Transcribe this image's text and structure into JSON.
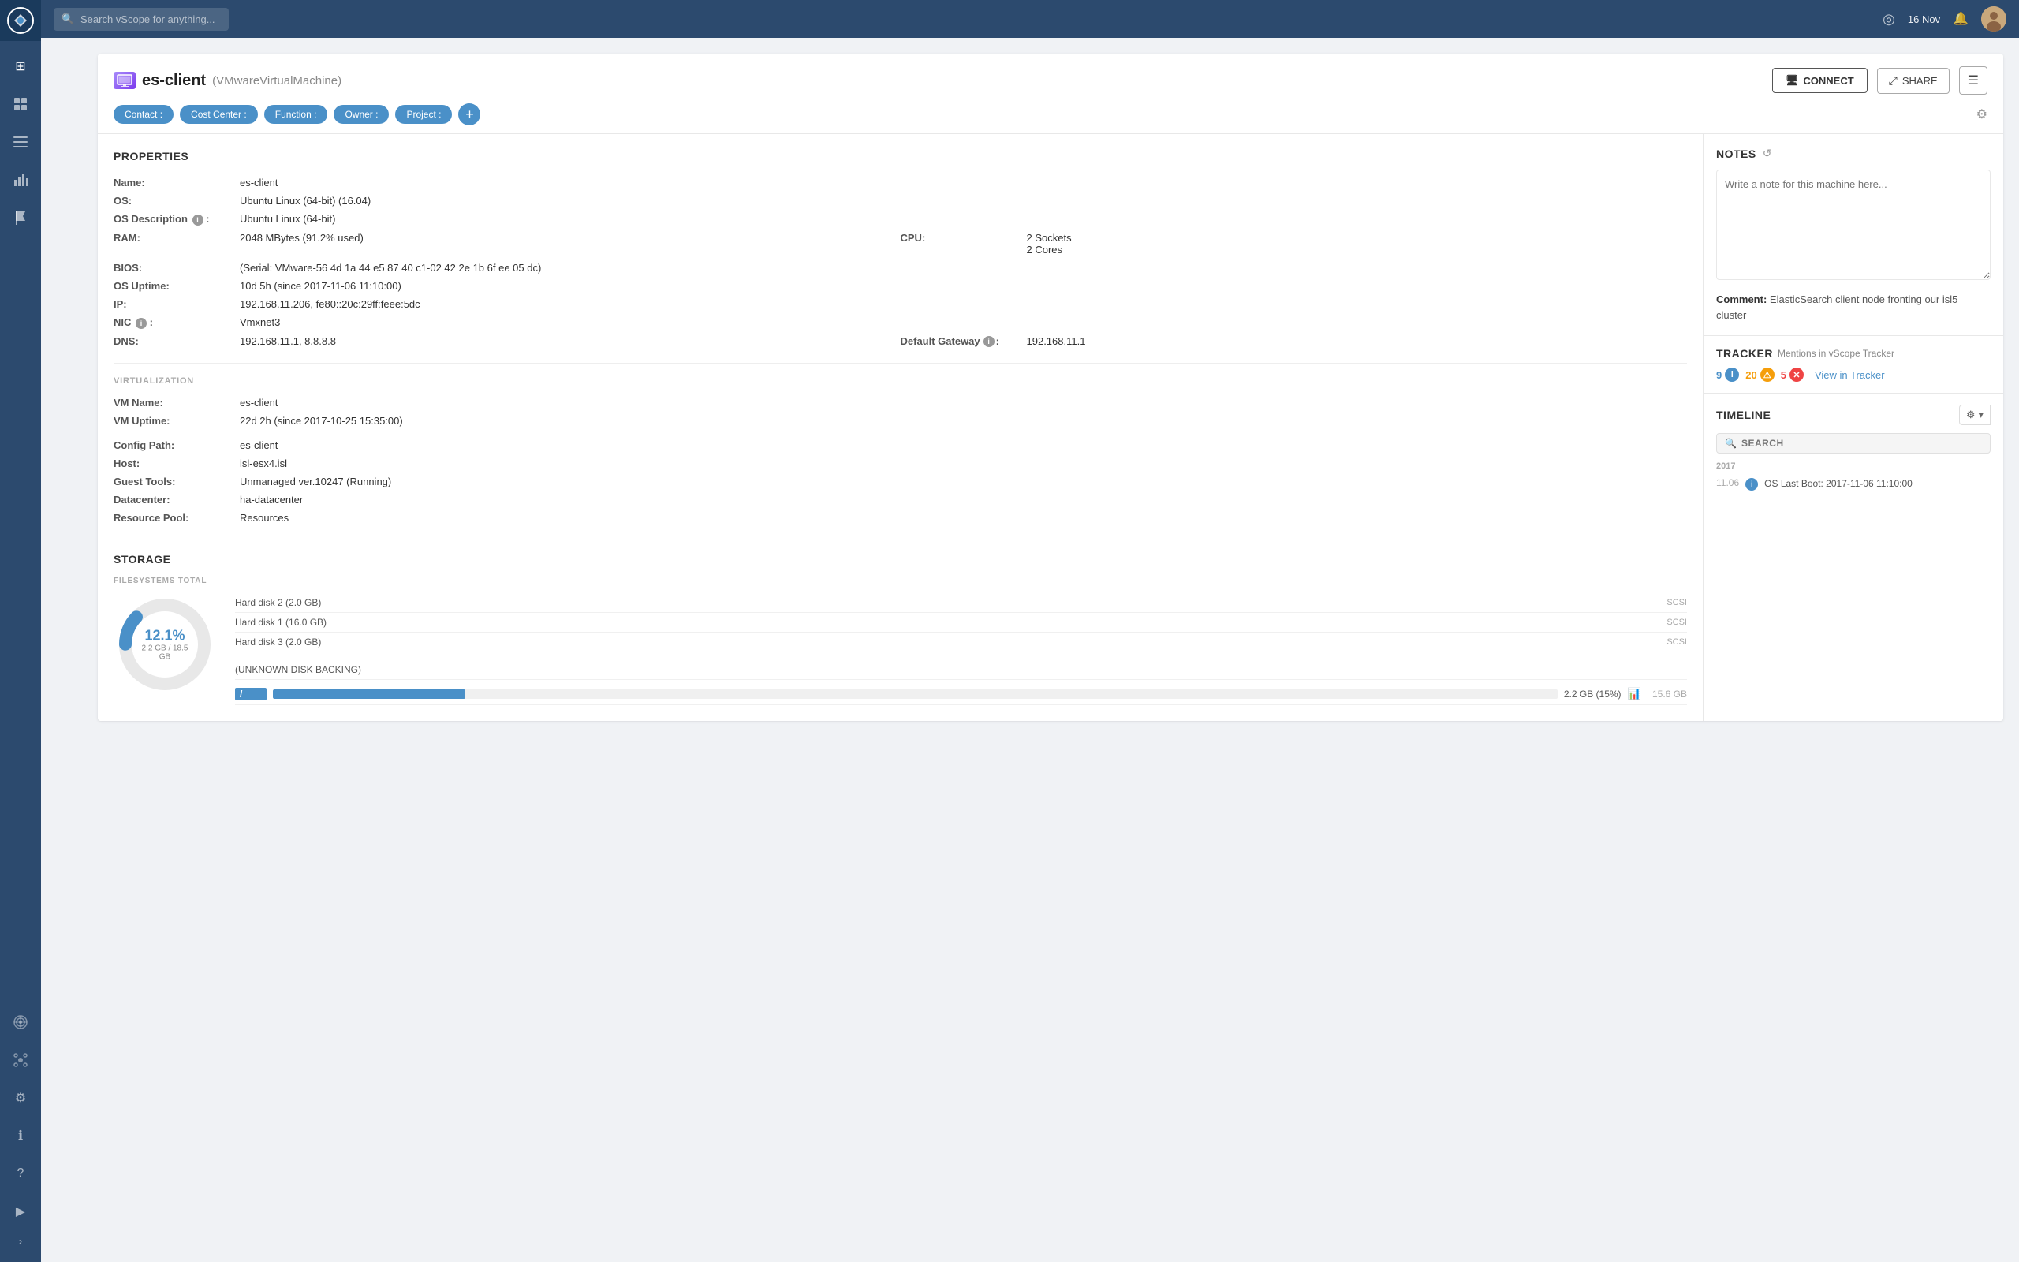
{
  "app": {
    "name": "vScope",
    "logo_text": "vScope"
  },
  "topnav": {
    "search_placeholder": "Search vScope for anything...",
    "date": "16 Nov",
    "connect_label": "CONNECT",
    "share_label": "SHARE"
  },
  "sidebar": {
    "icons": [
      {
        "name": "grid-icon",
        "symbol": "⊞",
        "active": true
      },
      {
        "name": "table-icon",
        "symbol": "☰"
      },
      {
        "name": "text-icon",
        "symbol": "≡"
      },
      {
        "name": "chart-icon",
        "symbol": "▦"
      },
      {
        "name": "flag-icon",
        "symbol": "⚑"
      },
      {
        "name": "globe-icon",
        "symbol": "◎"
      },
      {
        "name": "settings-icon",
        "symbol": "⚙"
      },
      {
        "name": "info-icon",
        "symbol": "ℹ"
      },
      {
        "name": "help-icon",
        "symbol": "?"
      },
      {
        "name": "video-icon",
        "symbol": "▶"
      }
    ],
    "expand_label": "›"
  },
  "page": {
    "vm_type": "VMwareVirtualMachine",
    "title": "es-client",
    "subtitle": "(VMwareVirtualMachine)",
    "tags": {
      "contact": "Contact :",
      "cost_center": "Cost Center :",
      "function": "Function :",
      "owner": "Owner :",
      "project": "Project :",
      "add_label": "+"
    }
  },
  "properties": {
    "section_title": "PROPERTIES",
    "fields": {
      "name_label": "Name:",
      "name_value": "es-client",
      "os_label": "OS:",
      "os_value": "Ubuntu Linux (64-bit) (16.04)",
      "os_desc_label": "OS Description",
      "os_desc_value": "Ubuntu Linux (64-bit)",
      "ram_label": "RAM:",
      "ram_value": "2048 MBytes (91.2% used)",
      "cpu_label": "CPU:",
      "cpu_value_sockets": "2 Sockets",
      "cpu_value_cores": "2 Cores",
      "bios_label": "BIOS:",
      "bios_value": "(Serial: VMware-56 4d 1a 44 e5 87 40 c1-02 42 2e 1b 6f ee 05 dc)",
      "os_uptime_label": "OS Uptime:",
      "os_uptime_value": "10d 5h (since 2017-11-06 11:10:00)",
      "ip_label": "IP:",
      "ip_value": "192.168.11.206, fe80::20c:29ff:feee:5dc",
      "nic_label": "NIC",
      "nic_value": "Vmxnet3",
      "dns_label": "DNS:",
      "dns_value": "192.168.11.1, 8.8.8.8",
      "gw_label": "Default Gateway",
      "gw_value": "192.168.11.1"
    },
    "virtualization": {
      "section_title": "VIRTUALIZATION",
      "vm_name_label": "VM Name:",
      "vm_name_value": "es-client",
      "vm_uptime_label": "VM Uptime:",
      "vm_uptime_value": "22d 2h (since 2017-10-25 15:35:00)",
      "config_path_label": "Config Path:",
      "config_path_value": "es-client",
      "host_label": "Host:",
      "host_value": "isl-esx4.isl",
      "guest_tools_label": "Guest Tools:",
      "guest_tools_value": "Unmanaged ver.10247 (Running)",
      "datacenter_label": "Datacenter:",
      "datacenter_value": "ha-datacenter",
      "resource_pool_label": "Resource Pool:",
      "resource_pool_value": "Resources"
    }
  },
  "notes": {
    "title": "NOTES",
    "placeholder": "Write a note for this machine here...",
    "comment_label": "Comment:",
    "comment_text": "ElasticSearch client node fronting our isl5 cluster"
  },
  "storage": {
    "title": "STORAGE",
    "filesystems_label": "FILESYSTEMS TOTAL",
    "donut_pct": "12.1%",
    "donut_sub": "2.2 GB / 18.5 GB",
    "disks": [
      {
        "name": "Hard disk 2 (2.0 GB)",
        "type": "SCSI"
      },
      {
        "name": "Hard disk 1 (16.0 GB)",
        "type": "SCSI"
      },
      {
        "name": "Hard disk 3 (2.0 GB)",
        "type": "SCSI"
      },
      {
        "name": "(UNKNOWN DISK BACKING)",
        "type": ""
      }
    ],
    "filesystems": [
      {
        "name": "/",
        "pct": 15,
        "pct_label": "2.2 GB (15%)",
        "size": "15.6 GB"
      }
    ]
  },
  "tracker": {
    "title": "TRACKER",
    "subtitle": "Mentions in vScope Tracker",
    "info_count": "9",
    "warn_count": "20",
    "error_count": "5",
    "view_label": "View in Tracker"
  },
  "timeline": {
    "title": "TIMELINE",
    "search_placeholder": "SEARCH",
    "year": "2017",
    "entry_date": "11.06",
    "entry_icon": "info",
    "entry_text": "OS Last Boot: 2017-11-06 11:10:00"
  }
}
